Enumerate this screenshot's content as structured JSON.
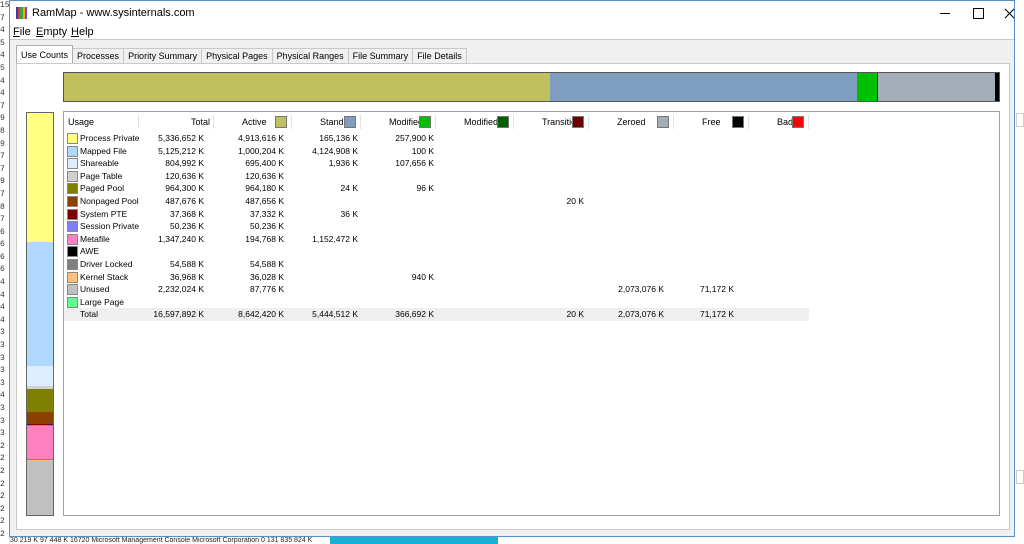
{
  "background": {
    "left_glyphs": [
      "15",
      "7",
      "4",
      "5",
      "4",
      "5",
      "4",
      "4",
      "7",
      "9",
      "8",
      "9",
      "7",
      "7",
      "9",
      "7",
      "8",
      "7",
      "6",
      "6",
      "6",
      "6",
      "4",
      "4",
      "4",
      "4",
      "3",
      "3",
      "3",
      "3",
      "3",
      "4",
      "3",
      "3",
      "3",
      "2",
      "2",
      "2",
      "2",
      "2",
      "2",
      "2",
      "2"
    ],
    "bottom_text": "30 219 K     97 448 K    16720 Microsoft Management Console    Microsoft Corporation         0 131 835 824 K"
  },
  "window": {
    "title": "RamMap - www.sysinternals.com",
    "icon_colors": [
      "#3a3aa8",
      "#d93a3a",
      "#3aa83a",
      "#e0b020",
      "#8a3ad9"
    ]
  },
  "menu": [
    "File",
    "Empty",
    "Help"
  ],
  "tabs": [
    {
      "label": "Use Counts",
      "active": true
    },
    {
      "label": "Processes",
      "active": false
    },
    {
      "label": "Priority Summary",
      "active": false
    },
    {
      "label": "Physical Pages",
      "active": false
    },
    {
      "label": "Physical Ranges",
      "active": false
    },
    {
      "label": "File Summary",
      "active": false
    },
    {
      "label": "File Details",
      "active": false
    }
  ],
  "memory_bar": [
    {
      "name": "Active",
      "fraction": 0.5207,
      "color": "#c0c060"
    },
    {
      "name": "Standby",
      "fraction": 0.328,
      "color": "#7f9dbf"
    },
    {
      "name": "Modified",
      "fraction": 0.0221,
      "color": "#00c000"
    },
    {
      "name": "Transition",
      "fraction": 0.0012,
      "color": "#6b0000"
    },
    {
      "name": "Zeroed",
      "fraction": 0.1248,
      "color": "#a3aeb8"
    },
    {
      "name": "Free",
      "fraction": 0.0043,
      "color": "#000000"
    }
  ],
  "usage_bar": [
    {
      "name": "Process Private",
      "fraction": 0.3215,
      "color": "#ffff80"
    },
    {
      "name": "Mapped File",
      "fraction": 0.3088,
      "color": "#b0d8ff"
    },
    {
      "name": "Shareable",
      "fraction": 0.0485,
      "color": "#ddeeff"
    },
    {
      "name": "Page Table",
      "fraction": 0.0073,
      "color": "#d0d0d0"
    },
    {
      "name": "Paged Pool",
      "fraction": 0.0581,
      "color": "#808000"
    },
    {
      "name": "Nonpaged Pool",
      "fraction": 0.0294,
      "color": "#8b4000"
    },
    {
      "name": "System PTE",
      "fraction": 0.0023,
      "color": "#800000"
    },
    {
      "name": "Session Private",
      "fraction": 0.003,
      "color": "#8080ff"
    },
    {
      "name": "Metafile",
      "fraction": 0.0812,
      "color": "#ff80c0"
    },
    {
      "name": "Driver Locked",
      "fraction": 0.0033,
      "color": "#808080"
    },
    {
      "name": "Kernel Stack",
      "fraction": 0.0022,
      "color": "#ffc080"
    },
    {
      "name": "Unused",
      "fraction": 0.1345,
      "color": "#c0c0c0"
    }
  ],
  "table": {
    "columns": [
      {
        "label": "Usage",
        "color": null
      },
      {
        "label": "Total",
        "color": null
      },
      {
        "label": "Active",
        "color": "#c0c060"
      },
      {
        "label": "Standby",
        "color": "#7f9dbf"
      },
      {
        "label": "Modified",
        "color": "#00c000"
      },
      {
        "label": "Modified ...",
        "color": "#006000"
      },
      {
        "label": "Transition",
        "color": "#6b0000"
      },
      {
        "label": "Zeroed",
        "color": "#a3aeb8"
      },
      {
        "label": "Free",
        "color": "#000000"
      },
      {
        "label": "Bad",
        "color": "#ff0000"
      }
    ],
    "rows": [
      {
        "label": "Process Private",
        "color": "#ffff80",
        "values": [
          "5,336,652 K",
          "4,913,616 K",
          "165,136 K",
          "257,900 K",
          "",
          "",
          "",
          "",
          ""
        ]
      },
      {
        "label": "Mapped File",
        "color": "#b0d8ff",
        "values": [
          "5,125,212 K",
          "1,000,204 K",
          "4,124,908 K",
          "100 K",
          "",
          "",
          "",
          "",
          ""
        ]
      },
      {
        "label": "Shareable",
        "color": "#ddeeff",
        "values": [
          "804,992 K",
          "695,400 K",
          "1,936 K",
          "107,656 K",
          "",
          "",
          "",
          "",
          ""
        ]
      },
      {
        "label": "Page Table",
        "color": "#d0d0d0",
        "values": [
          "120,636 K",
          "120,636 K",
          "",
          "",
          "",
          "",
          "",
          "",
          ""
        ]
      },
      {
        "label": "Paged Pool",
        "color": "#808000",
        "values": [
          "964,300 K",
          "964,180 K",
          "24 K",
          "96 K",
          "",
          "",
          "",
          "",
          ""
        ]
      },
      {
        "label": "Nonpaged Pool",
        "color": "#8b4000",
        "values": [
          "487,676 K",
          "487,656 K",
          "",
          "",
          "",
          "20 K",
          "",
          "",
          ""
        ]
      },
      {
        "label": "System PTE",
        "color": "#800000",
        "values": [
          "37,368 K",
          "37,332 K",
          "36 K",
          "",
          "",
          "",
          "",
          "",
          ""
        ]
      },
      {
        "label": "Session Private",
        "color": "#8080ff",
        "values": [
          "50,236 K",
          "50,236 K",
          "",
          "",
          "",
          "",
          "",
          "",
          ""
        ]
      },
      {
        "label": "Metafile",
        "color": "#ff80c0",
        "values": [
          "1,347,240 K",
          "194,768 K",
          "1,152,472 K",
          "",
          "",
          "",
          "",
          "",
          ""
        ]
      },
      {
        "label": "AWE",
        "color": "#000000",
        "values": [
          "",
          "",
          "",
          "",
          "",
          "",
          "",
          "",
          ""
        ]
      },
      {
        "label": "Driver Locked",
        "color": "#808080",
        "values": [
          "54,588 K",
          "54,588 K",
          "",
          "",
          "",
          "",
          "",
          "",
          ""
        ]
      },
      {
        "label": "Kernel Stack",
        "color": "#ffc080",
        "values": [
          "36,968 K",
          "36,028 K",
          "",
          "940 K",
          "",
          "",
          "",
          "",
          ""
        ]
      },
      {
        "label": "Unused",
        "color": "#c0c0c0",
        "values": [
          "2,232,024 K",
          "87,776 K",
          "",
          "",
          "",
          "",
          "2,073,076 K",
          "71,172 K",
          ""
        ]
      },
      {
        "label": "Large Page",
        "color": "#60ff90",
        "values": [
          "",
          "",
          "",
          "",
          "",
          "",
          "",
          "",
          ""
        ]
      }
    ],
    "total": {
      "label": "Total",
      "values": [
        "16,597,892 K",
        "8,642,420 K",
        "5,444,512 K",
        "366,692 K",
        "",
        "20 K",
        "2,073,076 K",
        "71,172 K",
        ""
      ]
    }
  }
}
